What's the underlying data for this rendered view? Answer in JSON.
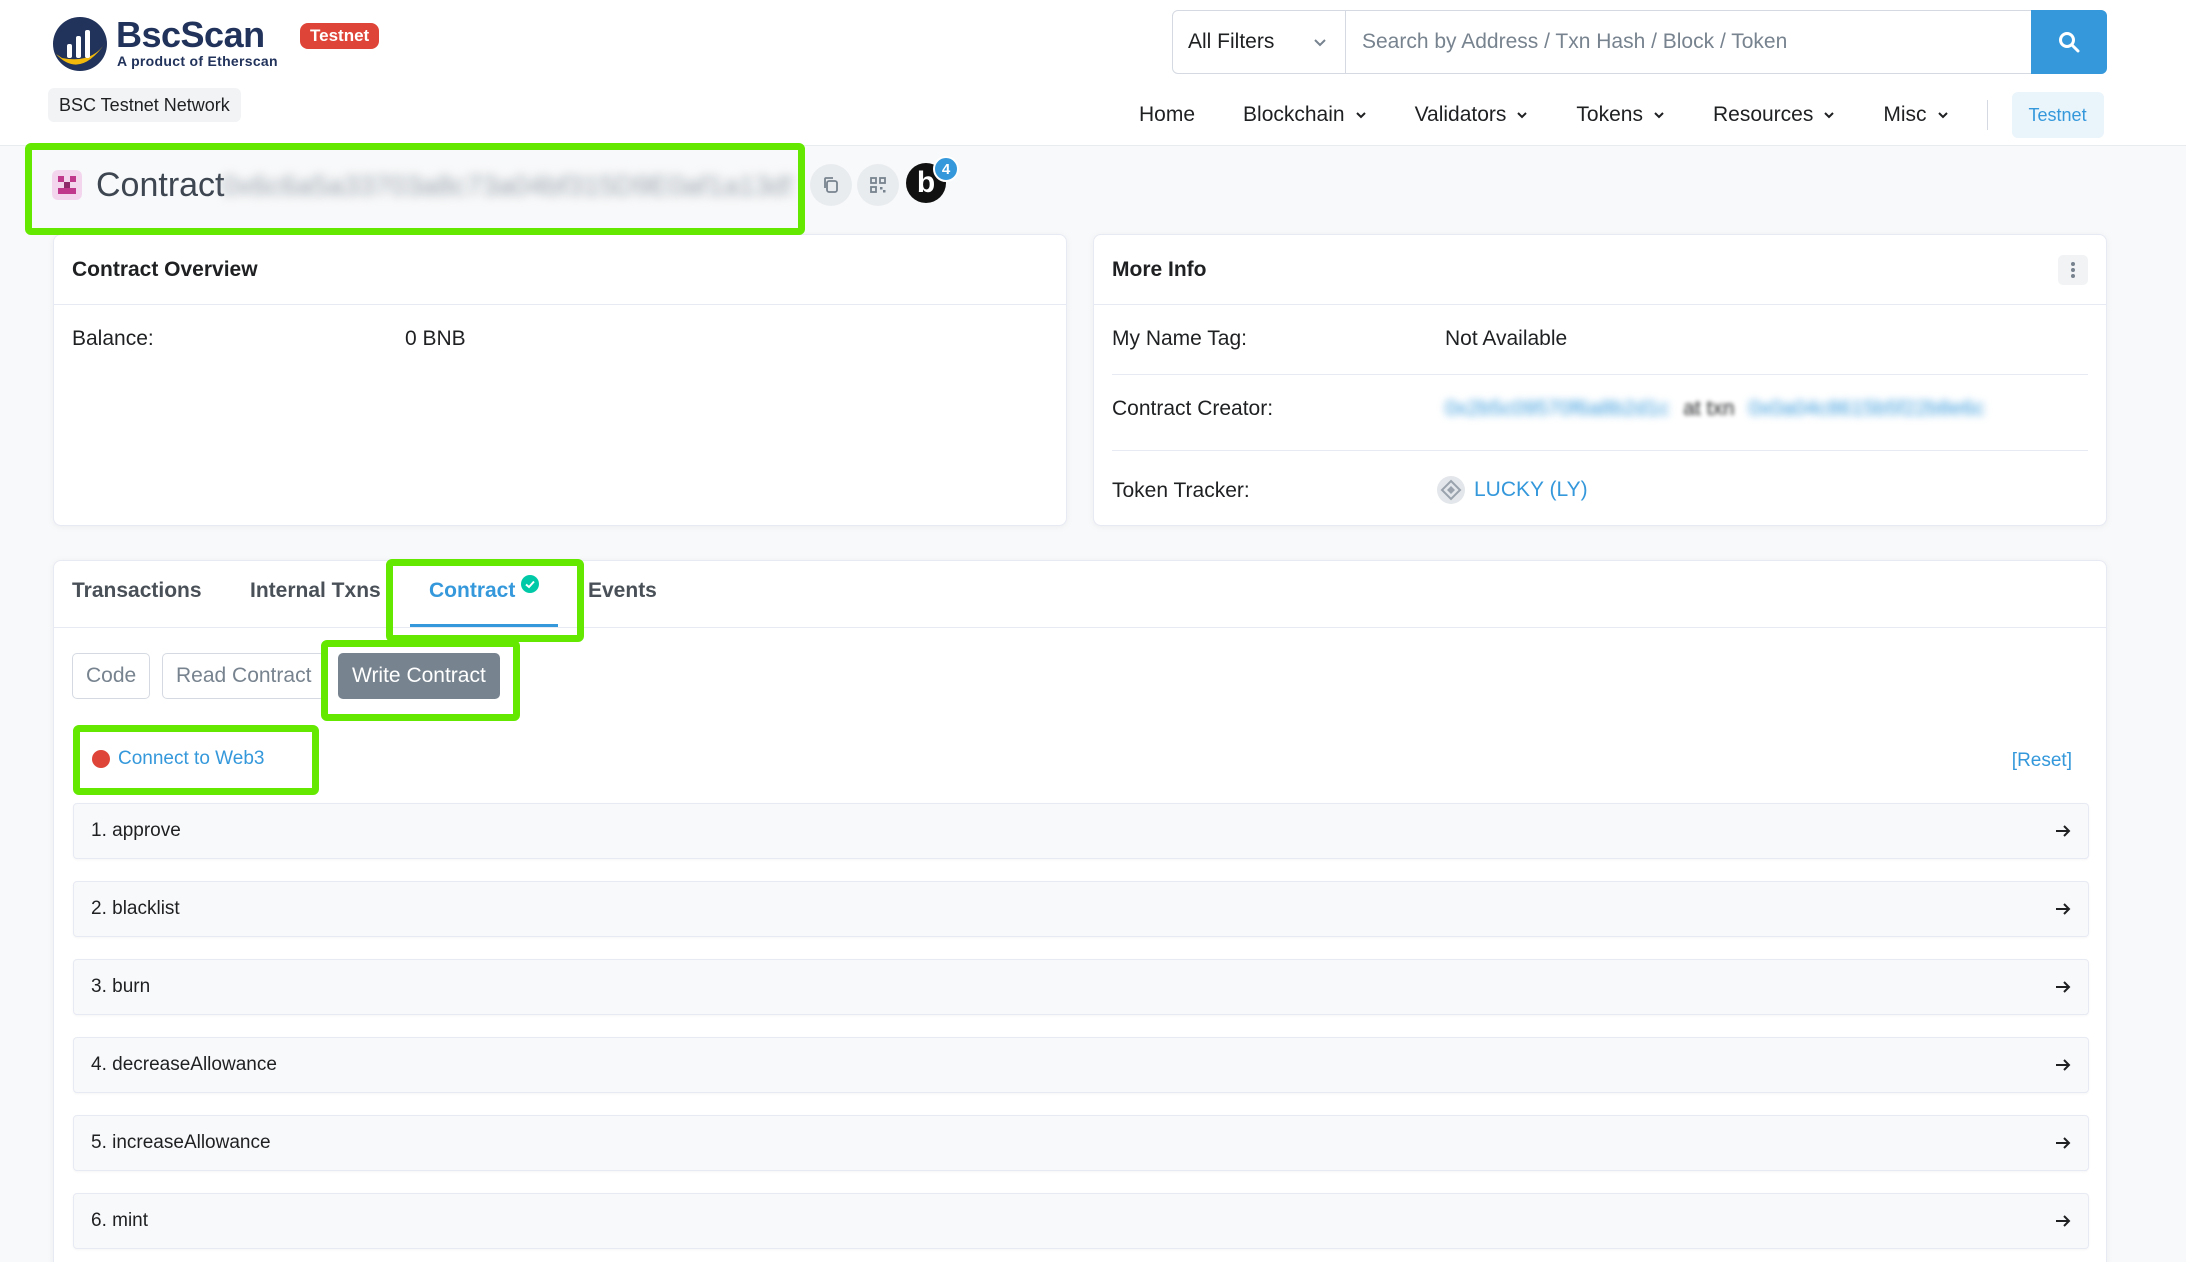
{
  "header": {
    "brand_name": "BscScan",
    "brand_tagline": "A product of Etherscan",
    "testnet_badge": "Testnet",
    "network_label": "BSC Testnet Network",
    "filter_label": "All Filters",
    "search_placeholder": "Search by Address / Txn Hash / Block / Token",
    "nav": [
      {
        "label": "Home",
        "has_menu": false
      },
      {
        "label": "Blockchain",
        "has_menu": true
      },
      {
        "label": "Validators",
        "has_menu": true
      },
      {
        "label": "Tokens",
        "has_menu": true
      },
      {
        "label": "Resources",
        "has_menu": true
      },
      {
        "label": "Misc",
        "has_menu": true
      }
    ],
    "network_button": "Testnet"
  },
  "title_row": {
    "label": "Contract",
    "address_blurred": "0x6c6a5a33703a8c73a04bf315D9E0af1a13d5c4a7",
    "blockscan_label": "b",
    "blockscan_count": "4"
  },
  "overview": {
    "title": "Contract Overview",
    "balance_label": "Balance:",
    "balance_value": "0 BNB"
  },
  "more_info": {
    "title": "More Info",
    "name_tag_label": "My Name Tag:",
    "name_tag_value": "Not Available",
    "creator_label": "Contract Creator:",
    "creator_address_blurred": "0x2b5c09570f6a8b2d1c",
    "creator_at_text": "at txn",
    "creator_txn_blurred": "0x0a04c8615b5f22b8e6c",
    "token_tracker_label": "Token Tracker:",
    "token_tracker_value": "LUCKY (LY)"
  },
  "tabs": {
    "items": [
      "Transactions",
      "Internal Txns",
      "Contract",
      "Events"
    ],
    "active": "Contract"
  },
  "contract_subtabs": [
    "Code",
    "Read Contract",
    "Write Contract"
  ],
  "write_panel": {
    "connect_label": "Connect to Web3",
    "reset_label": "[Reset]",
    "functions": [
      "1. approve",
      "2. blacklist",
      "3. burn",
      "4. decreaseAllowance",
      "5. increaseAllowance",
      "6. mint"
    ]
  },
  "colors": {
    "accent": "#3498db",
    "badge_red": "#de4437",
    "highlight": "#64e800",
    "verified": "#00c9a7"
  }
}
